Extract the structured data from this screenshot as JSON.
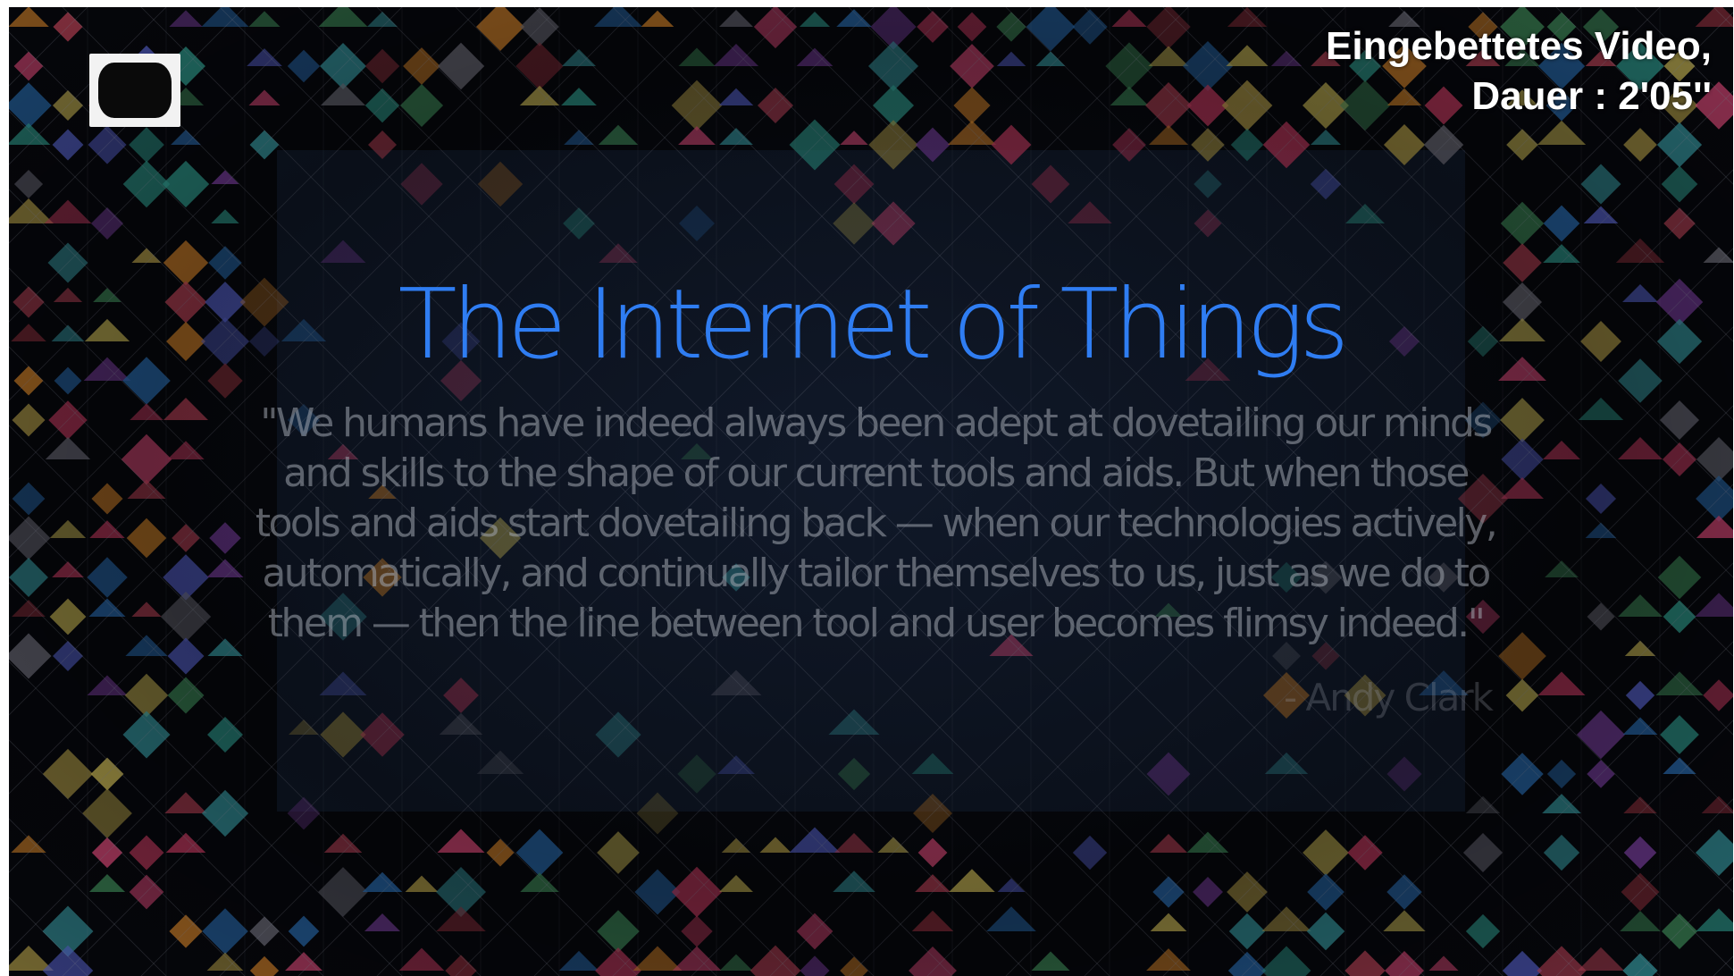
{
  "video": {
    "embed_label_line1": "Eingebettetes Video,",
    "embed_label_line2": "Dauer : 2'05''",
    "slide_title": "The Internet of Things",
    "quote": "\"We humans have indeed always been adept at dovetailing our minds and skills to the shape of our current tools and aids. But when those tools and aids start dovetailing back — when our technologies actively, automatically, and continually tailor themselves to us, just as we do to them — then the line between tool and user becomes flimsy indeed.\"",
    "quote_author": "- Andy Clark"
  },
  "colors": {
    "title": "#2f7df2",
    "background": "#06070c",
    "label": "#ffffff"
  },
  "icons": {
    "channel_logo": "tv-channel-logo-icon"
  }
}
